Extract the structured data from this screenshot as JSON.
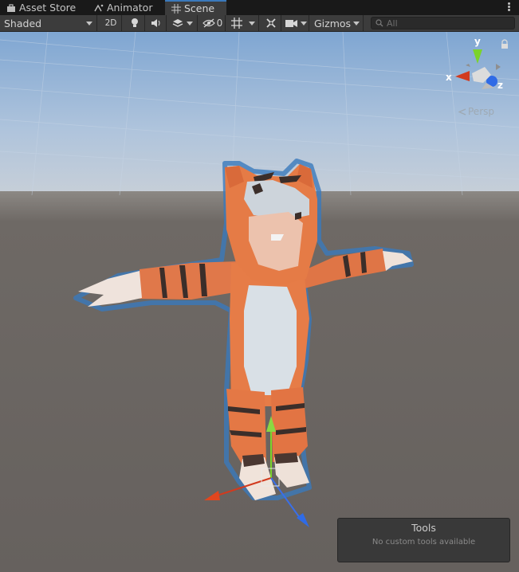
{
  "tabs": [
    {
      "label": "Asset Store",
      "icon": "bag-icon"
    },
    {
      "label": "Animator",
      "icon": "animator-icon"
    },
    {
      "label": "Scene",
      "icon": "grid-icon",
      "active": true
    }
  ],
  "toolbar": {
    "shading_mode": "Shaded",
    "mode_2d": "2D",
    "hidden_count": "0",
    "gizmos_label": "Gizmos"
  },
  "search": {
    "placeholder": "All"
  },
  "orientation_gizmo": {
    "axis_y": "y",
    "axis_x": "x",
    "axis_z": "z",
    "projection_label": "Persp"
  },
  "tools_overlay": {
    "title": "Tools",
    "message": "No custom tools available"
  },
  "colors": {
    "accent": "#3a79bb",
    "axis_x": "#d23a1e",
    "axis_y": "#7bd32b",
    "axis_z": "#3a6fe8",
    "tiger_orange": "#e77b46",
    "ground": "#6b6663",
    "sky_top": "#7ea8d6"
  }
}
